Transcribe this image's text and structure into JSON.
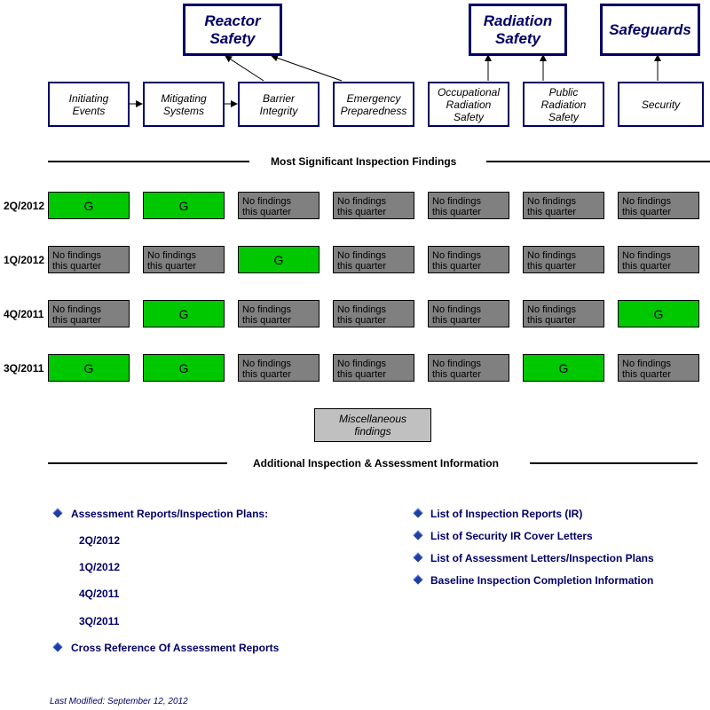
{
  "categories": {
    "reactor_safety": "Reactor Safety",
    "radiation_safety": "Radiation Safety",
    "safeguards": "Safeguards"
  },
  "cornerstones": [
    {
      "id": "initiating-events",
      "label": "Initiating Events"
    },
    {
      "id": "mitigating-systems",
      "label": "Mitigating Systems"
    },
    {
      "id": "barrier-integrity",
      "label": "Barrier Integrity"
    },
    {
      "id": "emergency-preparedness",
      "label": "Emergency Preparedness"
    },
    {
      "id": "occupational-radiation-safety",
      "label": "Occupational Radiation Safety"
    },
    {
      "id": "public-radiation-safety",
      "label": "Public Radiation Safety"
    },
    {
      "id": "security",
      "label": "Security"
    }
  ],
  "findings_section": {
    "title": "Most Significant Inspection Findings",
    "no_findings_text": "No findings this quarter",
    "colors": {
      "green": "#00c800",
      "none": "#808080"
    },
    "rows": [
      {
        "quarter": "2Q/2012",
        "cells": [
          "G",
          "G",
          "N",
          "N",
          "N",
          "N",
          "N"
        ]
      },
      {
        "quarter": "1Q/2012",
        "cells": [
          "N",
          "N",
          "G",
          "N",
          "N",
          "N",
          "N"
        ]
      },
      {
        "quarter": "4Q/2011",
        "cells": [
          "N",
          "G",
          "N",
          "N",
          "N",
          "N",
          "G"
        ]
      },
      {
        "quarter": "3Q/2011",
        "cells": [
          "G",
          "G",
          "N",
          "N",
          "N",
          "G",
          "N"
        ]
      }
    ],
    "misc_label": "Miscellaneous findings"
  },
  "additional_section": {
    "title": "Additional Inspection & Assessment Information",
    "left_links": {
      "assessment_reports": "Assessment Reports/Inspection Plans:",
      "quarters": [
        "2Q/2012",
        "1Q/2012",
        "4Q/2011",
        "3Q/2011"
      ],
      "cross_reference": "Cross Reference Of Assessment Reports"
    },
    "right_links": [
      "List of Inspection Reports (IR)",
      "List of Security IR Cover Letters",
      "List of Assessment Letters/Inspection Plans",
      "Baseline Inspection Completion Information"
    ]
  },
  "footer": {
    "last_modified": "Last Modified:  September 12, 2012"
  }
}
